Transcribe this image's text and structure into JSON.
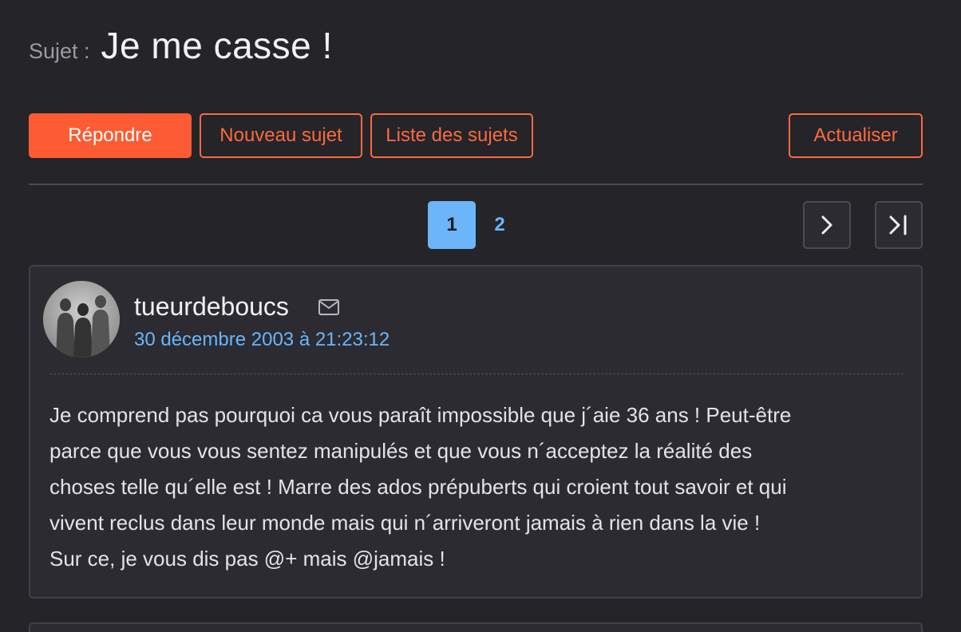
{
  "topic": {
    "prefix": "Sujet :",
    "title": "Je me casse !"
  },
  "toolbar": {
    "reply_label": "Répondre",
    "new_topic_label": "Nouveau sujet",
    "topic_list_label": "Liste des sujets",
    "refresh_label": "Actualiser"
  },
  "pagination": {
    "pages": [
      "1",
      "2"
    ],
    "current_page": "1",
    "next_icon": "chevron-right-icon",
    "last_icon": "last-page-icon"
  },
  "post": {
    "author": "tueurdeboucs",
    "date": "30 décembre 2003 à 21:23:12",
    "lines": [
      "Je comprend pas pourquoi ca vous paraît impossible que j´aie 36 ans ! Peut-être",
      "parce que vous vous sentez manipulés et que vous n´acceptez la réalité des",
      "choses telle qu´elle est ! Marre des ados prépuberts qui croient tout savoir et qui",
      "vivent reclus dans leur monde mais qui n´arriveront jamais à rien dans la vie !",
      "Sur ce, je vous dis pas @+ mais @jamais !"
    ]
  },
  "colors": {
    "background": "#242429",
    "accent": "#fd5b33",
    "link": "#6cb5f9",
    "card": "#2b2b31"
  }
}
